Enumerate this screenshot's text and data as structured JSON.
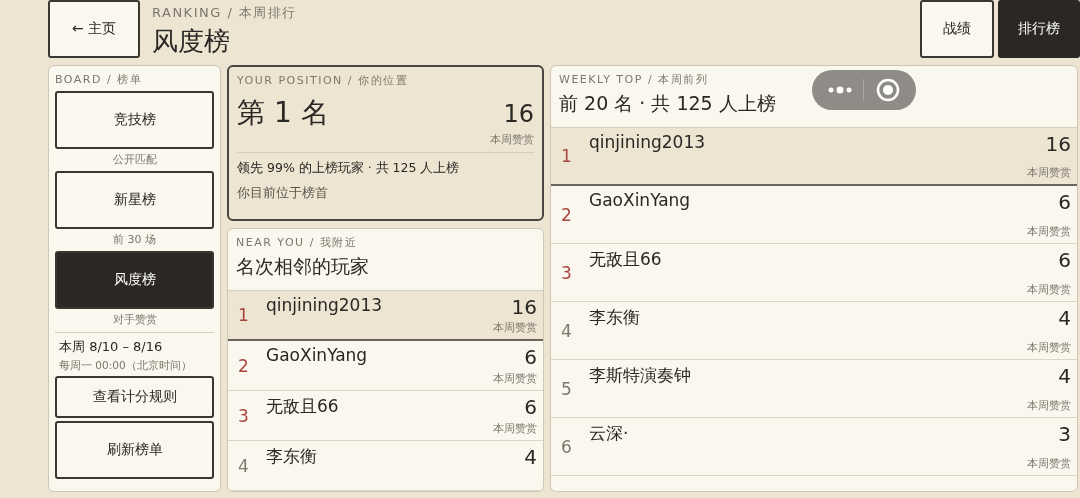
{
  "back_button": {
    "label": "← 主页"
  },
  "header": {
    "eyebrow": "RANKING / 本周排行",
    "title": "风度榜"
  },
  "tabs": [
    {
      "label": "战绩",
      "selected": false
    },
    {
      "label": "排行榜",
      "selected": true
    }
  ],
  "board": {
    "eyebrow": "BOARD / 榜单",
    "items": [
      {
        "label": "竞技榜",
        "caption": "公开匹配",
        "selected": false
      },
      {
        "label": "新星榜",
        "caption": "前 30 场",
        "selected": false
      },
      {
        "label": "风度榜",
        "caption": "对手赞赏",
        "selected": true
      }
    ],
    "week": "本周 8/10 – 8/16",
    "reset": "每周一 00:00（北京时间）",
    "buttons": [
      "查看计分规则",
      "刷新榜单"
    ]
  },
  "position": {
    "eyebrow": "YOUR POSITION / 你的位置",
    "rank": "第 1 名",
    "score": "16",
    "score_label": "本周赞赏",
    "summary": "领先 99% 的上榜玩家 · 共 125 人上榜",
    "note": "你目前位于榜首"
  },
  "near_you": {
    "eyebrow": "NEAR YOU / 我附近",
    "title": "名次相邻的玩家",
    "rows": [
      {
        "rank": "1",
        "name": "qinjining2013",
        "score": "16",
        "score_label": "本周赞赏",
        "podium": true,
        "self": true
      },
      {
        "rank": "2",
        "name": "GaoXinYang",
        "score": "6",
        "score_label": "本周赞赏",
        "podium": true,
        "self": false
      },
      {
        "rank": "3",
        "name": "无敌且66",
        "score": "6",
        "score_label": "本周赞赏",
        "podium": true,
        "self": false
      },
      {
        "rank": "4",
        "name": "李东衡",
        "score": "4",
        "podium": false,
        "self": false
      }
    ]
  },
  "weekly_top": {
    "eyebrow": "WEEKLY TOP / 本周前列",
    "title": "前 20 名 · 共 125 人上榜",
    "rows": [
      {
        "rank": "1",
        "name": "qinjining2013",
        "score": "16",
        "score_label": "本周赞赏",
        "podium": true,
        "self": true
      },
      {
        "rank": "2",
        "name": "GaoXinYang",
        "score": "6",
        "score_label": "本周赞赏",
        "podium": true,
        "self": false
      },
      {
        "rank": "3",
        "name": "无敌且66",
        "score": "6",
        "score_label": "本周赞赏",
        "podium": true,
        "self": false
      },
      {
        "rank": "4",
        "name": "李东衡",
        "score": "4",
        "score_label": "本周赞赏",
        "podium": false,
        "self": false
      },
      {
        "rank": "5",
        "name": "李斯特演奏钟",
        "score": "4",
        "score_label": "本周赞赏",
        "podium": false,
        "self": false
      },
      {
        "rank": "6",
        "name": "云深·",
        "score": "3",
        "score_label": "本周赞赏",
        "podium": false,
        "self": false
      }
    ]
  }
}
